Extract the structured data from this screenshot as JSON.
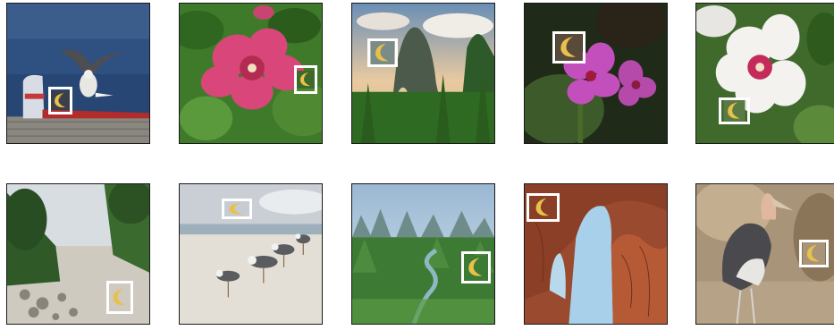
{
  "title": "",
  "grid": {
    "rows": 2,
    "columns": 5,
    "tiles": [
      {
        "scene": "seagull-on-red-boat",
        "detection": "banana-crescent"
      },
      {
        "scene": "pink-flower",
        "detection": "banana-crescent"
      },
      {
        "scene": "karst-mountain-landscape",
        "detection": "banana-crescent"
      },
      {
        "scene": "purple-flowers",
        "detection": "banana-crescent"
      },
      {
        "scene": "white-hibiscus",
        "detection": "banana-crescent"
      },
      {
        "scene": "sandy-path-with-trees",
        "detection": "banana-crescent"
      },
      {
        "scene": "seagulls-on-beach",
        "detection": "banana-crescent"
      },
      {
        "scene": "river-valley-mountains",
        "detection": "banana-crescent"
      },
      {
        "scene": "red-rock-arch",
        "detection": "banana-crescent"
      },
      {
        "scene": "marabou-stork",
        "detection": "banana-crescent"
      }
    ]
  },
  "colors": {
    "box_outline": "#ffffff",
    "tile_border": "#1a1a1a",
    "banana_yellow": "#e8c04a",
    "banana_shadow": "#b08a2a"
  }
}
